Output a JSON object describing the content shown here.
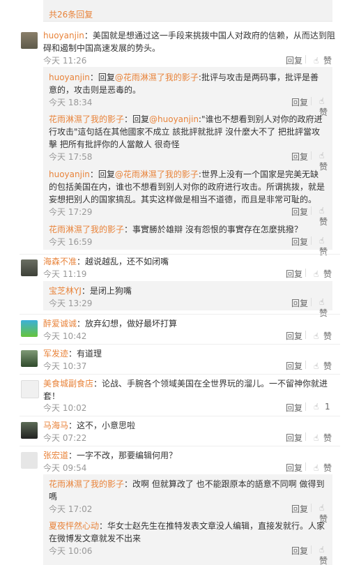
{
  "top": {
    "more_replies": "共26条回复"
  },
  "comments": [
    {
      "user": "huoyanjin",
      "text": "：美国就是想通过这一手段来挑拨中国人对政府的信赖，从而达到阻碍和遏制中国高速发展的势头。",
      "time": "今天 11:26",
      "reply": "回复",
      "like": "赞",
      "subs": [
        {
          "user": "huoyanjin",
          "pre": "：回复",
          "at": "@花雨淋濕了我的影子",
          "text": ":批评与攻击是两码事，批评是善意的，攻击则是恶毒的。",
          "time": "今天 18:34",
          "reply": "回复",
          "like": "赞"
        },
        {
          "user": "花雨淋濕了我的影子",
          "pre": "：回复",
          "at": "@huoyanjin",
          "text": ":\"谁也不想看到别人对你的政府进行攻击\"這句話在其他國家不成立  該批評就批評  沒什麼大不了  把批評當攻擊  把所有批評你的人當敵人  很奇怪",
          "time": "今天 17:58",
          "reply": "回复",
          "like": "赞"
        },
        {
          "user": "huoyanjin",
          "pre": "：回复",
          "at": "@花雨淋濕了我的影子",
          "text": ":世界上没有一个国家是完美无缺的包括美国在内，谁也不想看到别人对你的政府进行攻击。所谓挑拨，就是妄想把别人的国家搞乱。其实这样做是相当不道德，而且是非常可耻的。",
          "time": "今天 17:29",
          "reply": "回复",
          "like": "赞"
        },
        {
          "user": "花雨淋濕了我的影子",
          "pre": "",
          "at": "",
          "text": "：事實勝於雄辯   沒有怨恨的事實存在怎麼挑撥？",
          "time": "今天 16:59",
          "reply": "回复",
          "like": "赞"
        }
      ]
    },
    {
      "user": "海森不准",
      "text": "：越说越乱，还不如闭嘴",
      "time": "今天 11:19",
      "reply": "回复",
      "like": "赞",
      "subs": [
        {
          "user": "宝芝林YJ",
          "pre": "",
          "at": "",
          "text": "：是闭上狗嘴",
          "time": "今天 13:29",
          "reply": "回复",
          "like": "赞"
        }
      ]
    },
    {
      "user": "醉爱诚诚",
      "text": "：放弃幻想，做好最坏打算",
      "time": "今天 10:42",
      "reply": "回复",
      "like": "赞"
    },
    {
      "user": "军发迹",
      "text": "：有道理",
      "time": "今天 10:37",
      "reply": "回复",
      "like": "赞"
    },
    {
      "user": "美食城副食店",
      "text": "：论战、手腕各个领域美国在全世界玩的溜儿。一不留神你就进套！",
      "time": "今天 10:02",
      "reply": "回复",
      "like": "1"
    },
    {
      "user": "马海马",
      "text": "：这不，小意思啦",
      "time": "今天 07:22",
      "reply": "回复",
      "like": "赞"
    },
    {
      "user": "张宏道",
      "text": "：一字不改，那要编辑何用？",
      "time": "今天 09:54",
      "reply": "回复",
      "like": "赞",
      "subs": [
        {
          "user": "花雨淋濕了我的影子",
          "pre": "",
          "at": "",
          "text": "：改啊  但就算改了  也不能跟原本的語意不同啊  做得到嗎",
          "time": "今天 17:02",
          "reply": "回复",
          "like": "赞"
        },
        {
          "user": "夏夜怦然心动",
          "pre": "",
          "at": "",
          "text": "：华女士赵先生在推特发表文章没人编辑，直接发就行。人家在微博发文章就发不出来",
          "time": "今天 10:06",
          "reply": "回复",
          "like": "赞"
        }
      ]
    }
  ],
  "colors": {
    "accent": "#e8833a",
    "meta": "#999999",
    "subbg": "#f3f3f3"
  },
  "icons": {
    "like": "thumb-up-icon"
  }
}
